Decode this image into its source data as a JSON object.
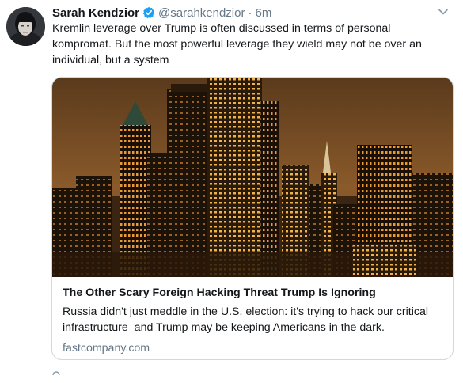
{
  "tweet": {
    "author_name": "Sarah Kendzior",
    "handle": "@sarahkendzior",
    "separator": "·",
    "time": "6m",
    "text": "Kremlin leverage over Trump is often discussed in terms of personal kompromat. But the most powerful leverage they wield may not be over an individual, but a system"
  },
  "card": {
    "title": "The Other Scary Foreign Hacking Threat Trump Is Ignoring",
    "description": "Russia didn't just meddle in the U.S. election: it's trying to hack our critical infrastructure–and Trump may be keeping Americans in the dark.",
    "domain": "fastcompany.com"
  },
  "icons": {
    "verified": "verified-badge-icon",
    "menu": "chevron-down-icon"
  },
  "colors": {
    "verified": "#1da1f2",
    "secondary_text": "#657786",
    "card_border": "#cfd9de"
  }
}
